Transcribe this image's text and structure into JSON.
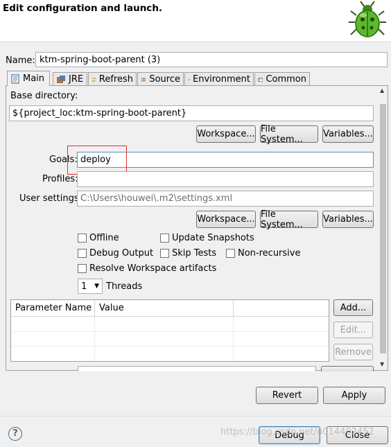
{
  "header": {
    "title": "Edit configuration and launch.",
    "icon": "bug-icon"
  },
  "name": {
    "label": "Name:",
    "value": "ktm-spring-boot-parent (3)"
  },
  "tabs": [
    {
      "label": "Main",
      "icon": "main-tab-icon"
    },
    {
      "label": "JRE",
      "icon": "jre-icon"
    },
    {
      "label": "Refresh",
      "icon": "refresh-icon"
    },
    {
      "label": "Source",
      "icon": "source-icon"
    },
    {
      "label": "Environment",
      "icon": "environment-icon"
    },
    {
      "label": "Common",
      "icon": "common-icon"
    }
  ],
  "main": {
    "base_directory_label": "Base directory:",
    "base_directory_value": "${project_loc:ktm-spring-boot-parent}",
    "workspace_btn": "Workspace...",
    "filesystem_btn": "File System...",
    "variables_btn": "Variables...",
    "goals_label": "Goals:",
    "goals_value": "deploy",
    "profiles_label": "Profiles:",
    "profiles_value": "",
    "user_settings_label": "User settings:",
    "user_settings_value": "C:\\Users\\houwei\\.m2\\settings.xml",
    "checkboxes": {
      "offline": "Offline",
      "update_snapshots": "Update Snapshots",
      "debug_output": "Debug Output",
      "skip_tests": "Skip Tests",
      "non_recursive": "Non-recursive",
      "resolve_workspace": "Resolve Workspace artifacts"
    },
    "threads_value": "1",
    "threads_label": "Threads",
    "table": {
      "columns": [
        "Parameter Name",
        "Value"
      ]
    },
    "add_btn": "Add...",
    "edit_btn": "Edit...",
    "remove_btn": "Remove"
  },
  "footer": {
    "revert_btn": "Revert",
    "apply_btn": "Apply",
    "debug_btn": "Debug",
    "close_btn": "Close",
    "watermark": "https://blog.csdn.net/u014402452"
  },
  "colors": {
    "highlight_box": "#e0302a",
    "accent": "#3c7fb1"
  }
}
